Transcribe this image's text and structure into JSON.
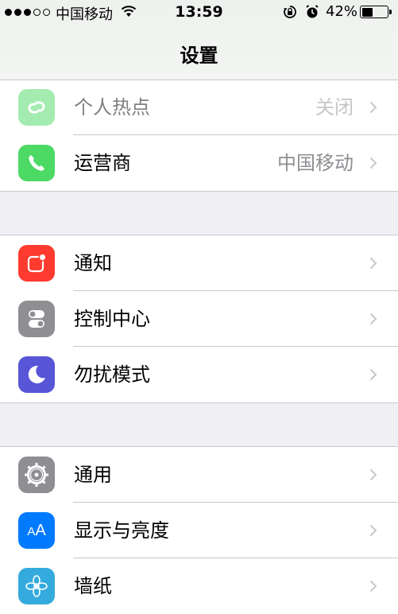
{
  "status_bar": {
    "carrier": "中国移动",
    "time": "13:59",
    "battery_percent_text": "42%",
    "battery_level": 0.42
  },
  "nav": {
    "title": "设置"
  },
  "groups": [
    {
      "rows": [
        {
          "label": "个人热点",
          "value": "关闭",
          "icon": "hotspot-icon",
          "color": "#4cd964"
        },
        {
          "label": "运营商",
          "value": "中国移动",
          "icon": "phone-icon",
          "color": "#4cd964"
        }
      ]
    },
    {
      "rows": [
        {
          "label": "通知",
          "icon": "notifications-icon",
          "color": "#ff3b30"
        },
        {
          "label": "控制中心",
          "icon": "control-center-icon",
          "color": "#8e8e93"
        },
        {
          "label": "勿扰模式",
          "icon": "moon-icon",
          "color": "#5856d6"
        }
      ]
    },
    {
      "rows": [
        {
          "label": "通用",
          "icon": "gear-icon",
          "color": "#8e8e93"
        },
        {
          "label": "显示与亮度",
          "icon": "display-brightness-icon",
          "color": "#007aff"
        },
        {
          "label": "墙纸",
          "icon": "wallpaper-flower-icon",
          "color": "#35aadc"
        }
      ]
    }
  ]
}
